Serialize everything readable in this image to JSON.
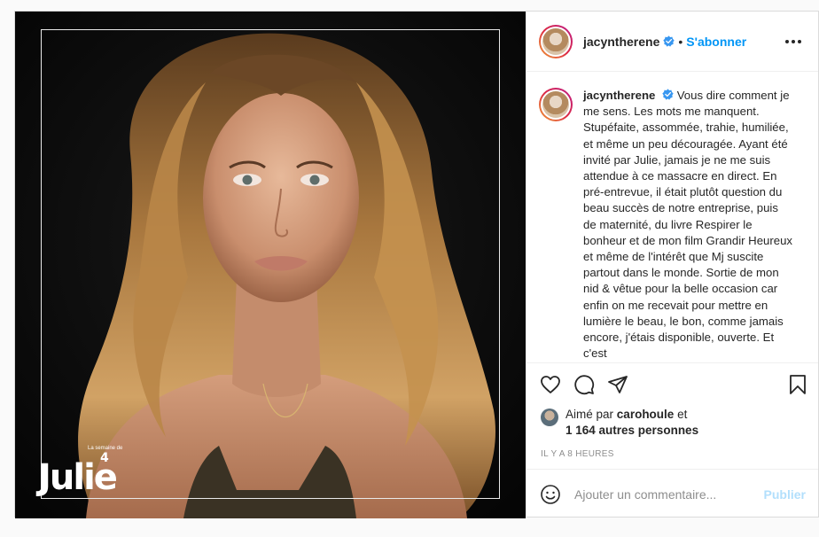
{
  "post": {
    "username": "jacyntherene",
    "follow_label": "S'abonner",
    "caption": "Vous dire comment je me sens. Les mots me manquent. Stupéfaite, assommée, trahie, humiliée, et même un peu découragée.  Ayant été invité par Julie, jamais je ne me suis attendue à ce massacre en direct. En pré-entrevue, il était plutôt question du beau succès de notre entreprise, puis de maternité, du livre Respirer le bonheur et de mon film Grandir Heureux et même de l'intérêt que Mj suscite partout dans le monde. Sortie de mon nid & vêtue pour la belle occasion car enfin on me recevait pour mettre en lumière le beau, le bon, comme jamais encore, j'étais disponible, ouverte. Et c'est",
    "liked_by_prefix": "Aimé par",
    "liked_by_user": "carohoule",
    "liked_by_and": "et",
    "liked_by_others": "1 164 autres personnes",
    "time_ago": "Il y a 8 heures",
    "comment_placeholder": "Ajouter un commentaire...",
    "publish_label": "Publier"
  },
  "photo": {
    "brand": "Julie",
    "brand_small": "La semaine de",
    "brand_number": "4"
  },
  "colors": {
    "accent": "#0095f6",
    "publish_disabled": "#b2dffc",
    "muted": "#8e8e8e",
    "text": "#262626"
  },
  "icons": [
    "verified-badge-icon",
    "more-options-icon",
    "heart-icon",
    "comment-icon",
    "share-icon",
    "bookmark-icon",
    "emoji-icon"
  ]
}
